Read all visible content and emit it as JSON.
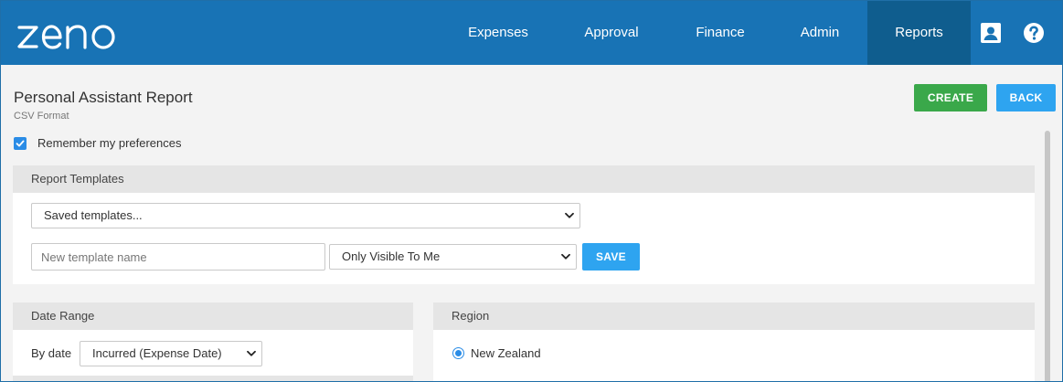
{
  "app": {
    "logo_text": "zeno",
    "brand_color": "#1873b5",
    "active_nav_color": "#0f5d8e"
  },
  "nav": {
    "items": [
      {
        "label": "Expenses"
      },
      {
        "label": "Approval"
      },
      {
        "label": "Finance"
      },
      {
        "label": "Admin"
      },
      {
        "label": "Reports",
        "active": true
      }
    ],
    "profile_icon": "user-card-icon",
    "help_icon": "question-circle-icon"
  },
  "page": {
    "title": "Personal Assistant Report",
    "subtitle": "CSV Format",
    "create_label": "CREATE",
    "back_label": "BACK",
    "remember_label": "Remember my preferences",
    "remember_checked": true
  },
  "templates_panel": {
    "heading": "Report Templates",
    "saved_templates_value": "Saved templates...",
    "new_template_placeholder": "New template name",
    "visibility_value": "Only Visible To Me",
    "save_label": "SAVE"
  },
  "date_panel": {
    "heading": "Date Range",
    "by_date_label": "By date",
    "by_date_value": "Incurred (Expense Date)"
  },
  "region_panel": {
    "heading": "Region",
    "options": [
      {
        "label": "New Zealand",
        "selected": true
      }
    ]
  }
}
